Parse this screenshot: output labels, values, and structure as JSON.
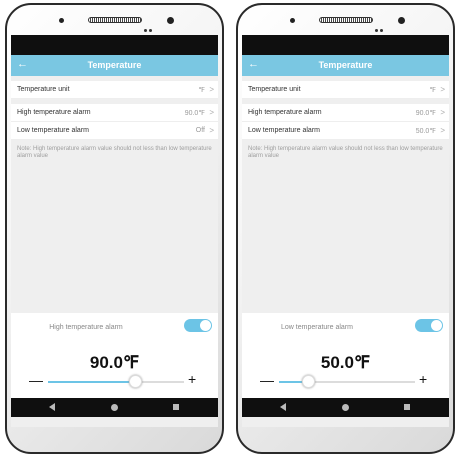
{
  "screens": [
    {
      "header": {
        "title": "Temperature"
      },
      "rows": [
        {
          "label": "Temperature unit",
          "value": "℉"
        },
        {
          "label": "High temperature alarm",
          "value": "90.0℉"
        },
        {
          "label": "Low temperature alarm",
          "value": "Off"
        }
      ],
      "note": "Note: High temperature alarm value should not less than low temperature alarm value",
      "sheet": {
        "label": "High temperature alarm",
        "toggle_on": true,
        "value": "90.0℉",
        "minus": "—",
        "plus": "+",
        "slider_fraction": 0.65
      }
    },
    {
      "header": {
        "title": "Temperature"
      },
      "rows": [
        {
          "label": "Temperature unit",
          "value": "℉"
        },
        {
          "label": "High temperature alarm",
          "value": "90.0℉"
        },
        {
          "label": "Low temperature alarm",
          "value": "50.0℉"
        }
      ],
      "note": "Note: High temperature alarm value should not less than low temperature alarm value",
      "sheet": {
        "label": "Low temperature alarm",
        "toggle_on": true,
        "value": "50.0℉",
        "minus": "—",
        "plus": "+",
        "slider_fraction": 0.22
      }
    }
  ],
  "icons": {
    "back": "back-arrow-icon",
    "chevron": "chevron-right-icon",
    "nav_back": "nav-back-icon",
    "nav_home": "nav-home-icon",
    "nav_recent": "nav-recent-icon"
  },
  "colors": {
    "accent": "#7ac7e2",
    "toggle": "#6cc4e6"
  }
}
